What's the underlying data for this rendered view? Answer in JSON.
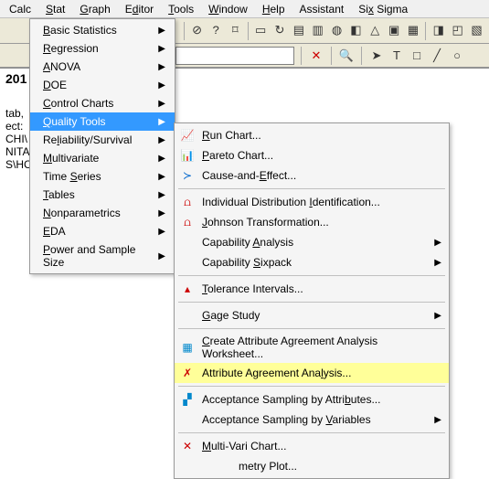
{
  "menubar": {
    "calc": "Calc",
    "stat": "Stat",
    "graph": "Graph",
    "editor": "Editor",
    "tools": "Tools",
    "window": "Window",
    "help": "Help",
    "assistant": "Assistant",
    "sixsigma": "Six Sigma"
  },
  "stat_menu": {
    "basic": "Basic Statistics",
    "regression": "Regression",
    "anova": "ANOVA",
    "doe": "DOE",
    "control": "Control Charts",
    "quality": "Quality Tools",
    "reliability": "Reliability/Survival",
    "multivariate": "Multivariate",
    "timeseries": "Time Series",
    "tables": "Tables",
    "nonparametrics": "Nonparametrics",
    "eda": "EDA",
    "power": "Power and Sample Size"
  },
  "quality_submenu": {
    "run": "Run Chart...",
    "pareto": "Pareto Chart...",
    "cause": "Cause-and-Effect...",
    "idi": "Individual Distribution Identification...",
    "johnson": "Johnson Transformation...",
    "capa": "Capability Analysis",
    "caps": "Capability Sixpack",
    "tol": "Tolerance Intervals...",
    "gage": "Gage Study",
    "createws": "Create Attribute Agreement Analysis Worksheet...",
    "attragree": "Attribute Agreement Analysis...",
    "accattr": "Acceptance Sampling by Attributes...",
    "accvar": "Acceptance Sampling by Variables",
    "multivari": "Multi-Vari Chart...",
    "sym": "metry Plot..."
  },
  "workspace": {
    "header": "201",
    "l1": "tab,",
    "l2": "ect:",
    "l3": "CHI\\",
    "l4": "NITA",
    "l5": "S\\HC"
  },
  "toolbar_glyphs": {
    "home": "⌂",
    "help": "⊘",
    "q": "?",
    "clip": "⌑",
    "doc": "▭",
    "a": "↻",
    "b": "▤",
    "c": "▥",
    "d": "◍",
    "e": "◧",
    "f": "△",
    "g": "▣",
    "h": "▦",
    "i": "◨",
    "j": "◰",
    "k": "▧"
  },
  "addr_glyphs": {
    "x": "✕",
    "mag": "🔍",
    "arrow": "➤",
    "t": "T",
    "box": "□",
    "line": "╱",
    "circ": "○"
  }
}
